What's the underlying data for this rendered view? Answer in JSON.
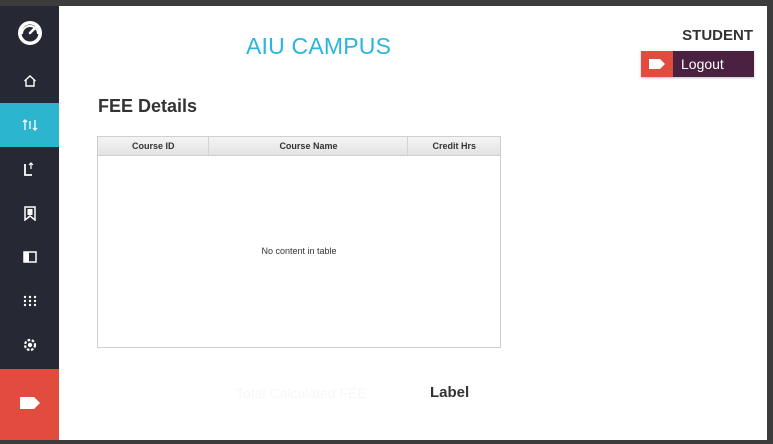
{
  "header": {
    "title": "AIU CAMPUS",
    "role": "STUDENT",
    "logout_label": "Logout"
  },
  "sidebar": {
    "items": [
      {
        "icon": "dashboard-icon"
      },
      {
        "icon": "home-icon"
      },
      {
        "icon": "fee-sort-icon",
        "active": true
      },
      {
        "icon": "book-icon"
      },
      {
        "icon": "bookmark-icon"
      },
      {
        "icon": "panel-icon"
      },
      {
        "icon": "grid-dots-icon"
      },
      {
        "icon": "settings-icon"
      }
    ],
    "logout_icon": "logout-tag-icon"
  },
  "main": {
    "section_title": "FEE Details",
    "table": {
      "columns": [
        "Course ID",
        "Course Name",
        "Credit Hrs"
      ],
      "rows": [],
      "empty_text": "No content in table"
    },
    "total_label": "Total Calculated FEE",
    "total_value": "Label"
  },
  "colors": {
    "accent": "#2bb5cf",
    "sidebar_bg": "#262833",
    "danger": "#e24c3f",
    "logout_bg": "#4a2140"
  }
}
